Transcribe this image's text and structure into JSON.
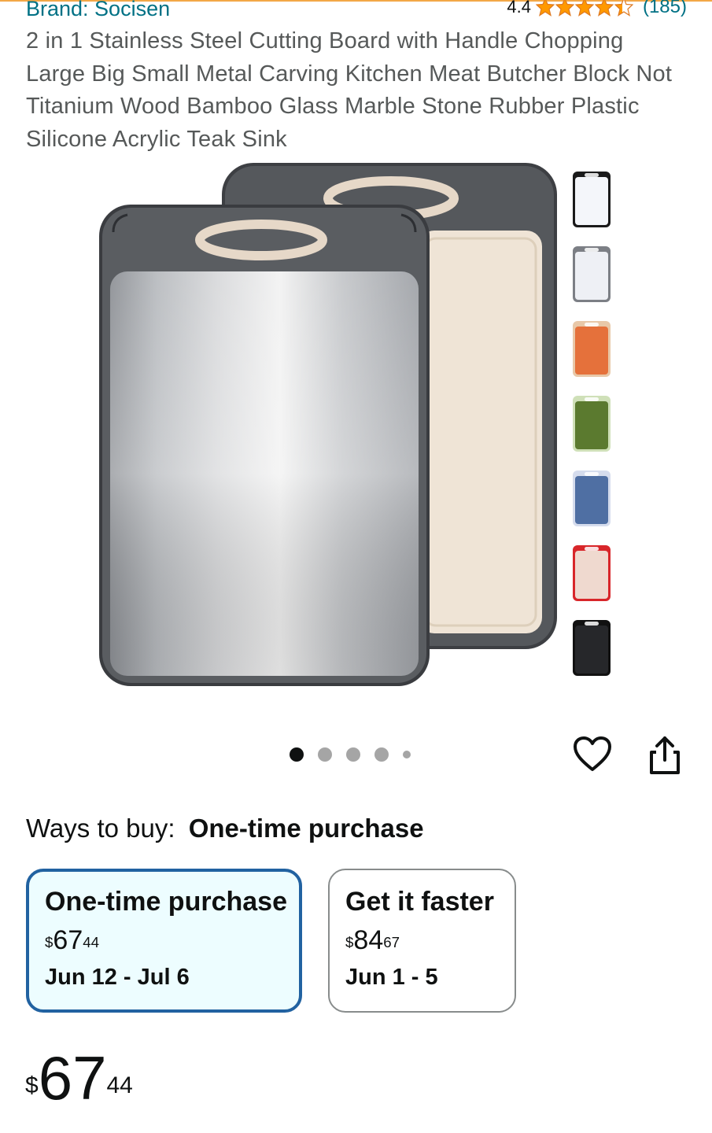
{
  "brand": {
    "label": "Brand: Socisen"
  },
  "rating": {
    "value": "4.4",
    "count": "(185)",
    "stars": 4.4,
    "icon": "star-icon",
    "color": "#ff9900"
  },
  "product": {
    "title": "2 in 1 Stainless Steel Cutting Board with Handle Chopping Large Big Small Metal Carving Kitchen Meat Butcher Block Not Titanium Wood Bamboo Glass Marble Stone Rubber Plastic Silicone Acrylic Teak Sink"
  },
  "gallery": {
    "thumbnails": [
      {
        "name": "thumbnail-white-grey",
        "color": "#f4f6fa",
        "rim": "#1a1a1a"
      },
      {
        "name": "thumbnail-light-grey",
        "color": "#eef0f5",
        "rim": "#7c7f85"
      },
      {
        "name": "thumbnail-orange",
        "color": "#e5713b",
        "rim": "#e8c8a8"
      },
      {
        "name": "thumbnail-green",
        "color": "#5b7a2f",
        "rim": "#cfe0b8"
      },
      {
        "name": "thumbnail-blue",
        "color": "#4f6fa3",
        "rim": "#d5dced"
      },
      {
        "name": "thumbnail-beige-red",
        "color": "#efd9cf",
        "rim": "#d8262a"
      },
      {
        "name": "thumbnail-black",
        "color": "#26272a",
        "rim": "#111111"
      }
    ],
    "dots": 5,
    "active_dot": 0
  },
  "actions": {
    "heart_icon": "heart-icon",
    "share_icon": "share-icon"
  },
  "ways_to_buy": {
    "label": "Ways to buy:",
    "selected": "One-time purchase"
  },
  "options": [
    {
      "title": "One-time purchase",
      "currency": "$",
      "dollars": "67",
      "cents": "44",
      "date": "Jun 12 - Jul 6"
    },
    {
      "title": "Get it faster",
      "currency": "$",
      "dollars": "84",
      "cents": "67",
      "date": "Jun 1 - 5"
    }
  ],
  "price": {
    "currency": "$",
    "dollars": "67",
    "cents": "44"
  },
  "colors": {
    "link": "#007185",
    "selected_border": "#2162a1",
    "selected_bg": "#edfdff"
  }
}
